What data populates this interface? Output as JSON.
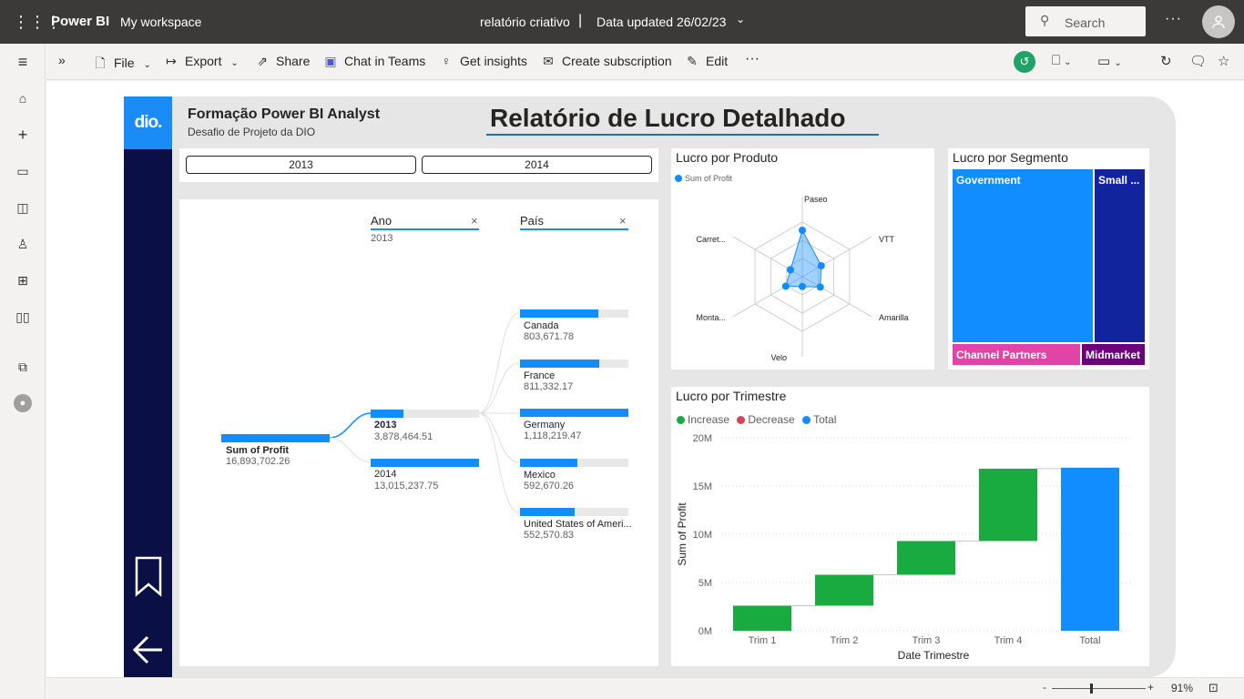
{
  "topbar": {
    "brand": "Power BI",
    "workspace": "My workspace",
    "report_name": "relatório criativo",
    "separator": "|",
    "data_updated": "Data updated 26/02/23",
    "search_placeholder": "Search"
  },
  "actionbar": {
    "file": "File",
    "export": "Export",
    "share": "Share",
    "chat": "Chat in Teams",
    "insights": "Get insights",
    "subscription": "Create subscription",
    "edit": "Edit"
  },
  "report": {
    "logo_text": "dio.",
    "course_title": "Formação Power BI Analyst",
    "course_subtitle": "Desafio de Projeto da DIO",
    "main_title": "Relatório de Lucro Detalhado",
    "year_slicer": [
      "2013",
      "2014"
    ]
  },
  "decomposition": {
    "col1_header": "Ano",
    "col1_filter": "2013",
    "col2_header": "País",
    "root": {
      "label": "Sum of Profit",
      "value": "16,893,702.26",
      "fraction": 1.0
    },
    "years": [
      {
        "label": "2013",
        "value": "3,878,464.51",
        "fraction": 0.3
      },
      {
        "label": "2014",
        "value": "13,015,237.75",
        "fraction": 1.0
      }
    ],
    "countries": [
      {
        "label": "Canada",
        "value": "803,671.78",
        "fraction": 0.72
      },
      {
        "label": "France",
        "value": "811,332.17",
        "fraction": 0.73
      },
      {
        "label": "Germany",
        "value": "1,118,219.47",
        "fraction": 1.0
      },
      {
        "label": "Mexico",
        "value": "592,670.26",
        "fraction": 0.53
      },
      {
        "label": "United States of Ameri...",
        "value": "552,570.83",
        "fraction": 0.5
      }
    ]
  },
  "radar": {
    "title": "Lucro por Produto",
    "legend": "Sum of Profit",
    "color": "#118dff",
    "axes": [
      "Paseo",
      "VTT",
      "Amarilla",
      "Velo",
      "Monta...",
      "Carret..."
    ],
    "values": [
      0.85,
      0.4,
      0.38,
      0.18,
      0.35,
      0.25
    ]
  },
  "treemap": {
    "title": "Lucro por Segmento",
    "segments": [
      {
        "label": "Government",
        "color": "#118dff"
      },
      {
        "label": "Small ...",
        "color": "#12239e"
      },
      {
        "label": "Channel Partners",
        "color": "#e044a7"
      },
      {
        "label": "Midmarket",
        "color": "#6b007b"
      }
    ]
  },
  "waterfall": {
    "title": "Lucro por Trimestre",
    "legend": [
      {
        "label": "Increase",
        "color": "#1aab40"
      },
      {
        "label": "Decrease",
        "color": "#d64554"
      },
      {
        "label": "Total",
        "color": "#118dff"
      }
    ]
  },
  "chart_data": {
    "type": "bar",
    "title": "Lucro por Trimestre",
    "xlabel": "Date Trimestre",
    "ylabel": "Sum of Profit",
    "categories": [
      "Trim 1",
      "Trim 2",
      "Trim 3",
      "Trim 4",
      "Total"
    ],
    "series": [
      {
        "name": "Increase",
        "values": [
          2.6,
          3.2,
          3.5,
          7.5,
          null
        ]
      },
      {
        "name": "Total",
        "values": [
          null,
          null,
          null,
          null,
          16.9
        ]
      }
    ],
    "y_ticks": [
      "0M",
      "5M",
      "10M",
      "15M",
      "20M"
    ],
    "ylim": [
      0,
      20
    ],
    "unit": "M"
  },
  "statusbar": {
    "minus": "-",
    "plus": "+",
    "zoom": "91%"
  }
}
